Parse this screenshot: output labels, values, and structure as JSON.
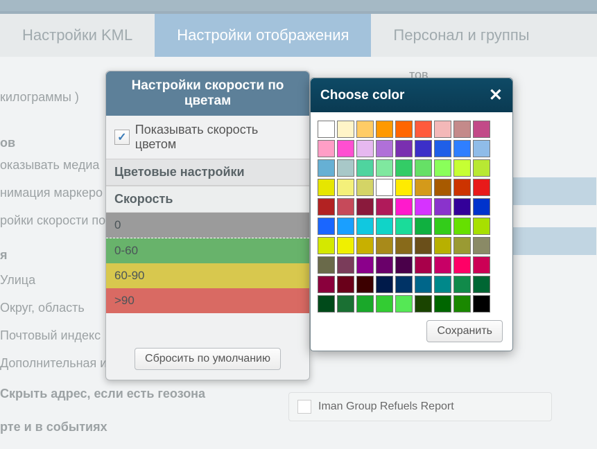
{
  "tabs": {
    "kml": "Настройки KML",
    "display": "Настройки отображения",
    "personnel": "Персонал и группы"
  },
  "bg": {
    "kg": "килограммы )",
    "fieldset_ov": "ов",
    "media": "оказывать медиа",
    "anim": "нимация маркеро",
    "speedcolor": "ройки скорости по",
    "fieldset_ya": "я",
    "street": "Улица",
    "district": "Округ, область",
    "zip": "Почтовый индекс",
    "extra": "Дополнительная и",
    "hide_addr": "Скрыть адрес, если есть геозона",
    "map_events": "рте и в событиях",
    "iman": "Iman Group Refuels Report",
    "tov": "тов"
  },
  "modal": {
    "title": "Настройки скорости по цветам",
    "show_speed": "Показывать скорость цветом",
    "color_settings": "Цветовые настройки",
    "speed": "Скорость",
    "rows": [
      "0",
      "0-60",
      "60-90",
      ">90"
    ],
    "reset": "Сбросить по умолчанию"
  },
  "picker": {
    "title": "Choose color",
    "save": "Сохранить",
    "colors": [
      "#ffffff",
      "#fff4c8",
      "#ffcc66",
      "#ff9900",
      "#ff6600",
      "#ff5a3c",
      "#f4b8b8",
      "#c48a8a",
      "#c24a88",
      "#ff9ec6",
      "#ff4fd1",
      "#e6b8f0",
      "#b070d8",
      "#7a2fb0",
      "#3c2fc8",
      "#1f5fe8",
      "#2f7fff",
      "#8fbce8",
      "#66b0d4",
      "#a8c8c8",
      "#4fd49f",
      "#7fe89f",
      "#33cc66",
      "#66e066",
      "#8aff5a",
      "#c6ff33",
      "#b8e833",
      "#e6e600",
      "#f4f07a",
      "#d4d466",
      "#ffffff",
      "#ffeb00",
      "#d49a1a",
      "#a85a00",
      "#cc3300",
      "#e81a1a",
      "#b22222",
      "#c64a5a",
      "#8a1a3c",
      "#b01a5a",
      "#ff1acc",
      "#d633ff",
      "#8a33cc",
      "#330099",
      "#0033cc",
      "#1a66ff",
      "#1a9fff",
      "#10c8e0",
      "#10d4c8",
      "#1adc9a",
      "#10b040",
      "#33cc1a",
      "#66e000",
      "#a8e000",
      "#d4e800",
      "#f0f000",
      "#c8b000",
      "#a88a1a",
      "#886a1a",
      "#6a4f1a",
      "#b8b000",
      "#9a9a33",
      "#8a8a66",
      "#6a6a4a",
      "#7a3c5a",
      "#8b008b",
      "#6a006a",
      "#4a004a",
      "#a8004a",
      "#c80066",
      "#ff0066",
      "#cc0055",
      "#8a003c",
      "#6a001a",
      "#3c0000",
      "#001a4a",
      "#003366",
      "#00668a",
      "#00888a",
      "#118a4a",
      "#006633",
      "#004a1a",
      "#1a7033",
      "#1aa82a",
      "#33cc33",
      "#55e855",
      "#1a4400",
      "#006600",
      "#1a8800",
      "#000000"
    ]
  }
}
